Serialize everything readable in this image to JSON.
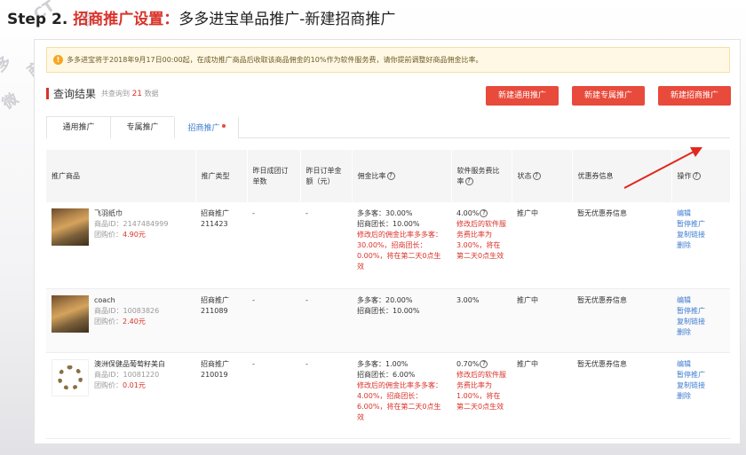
{
  "step": {
    "prefix": "Step 2.",
    "highlight": "招商推广设置：",
    "description": "多多进宝单品推广-新建招商推广"
  },
  "notice": {
    "text": "多多进宝将于2018年9月17日00:00起，在成功推广商品后收取该商品佣金的10%作为软件服务费，请你提前调整好商品佣金比率。"
  },
  "results": {
    "label": "查询结果",
    "count_prefix": "共查询到",
    "count": "21",
    "count_suffix": "数据"
  },
  "buttons": {
    "new_general": "新建通用推广",
    "new_exclusive": "新建专属推广",
    "new_merchant": "新建招商推广"
  },
  "tabs": [
    "通用推广",
    "专属推广",
    "招商推广"
  ],
  "table": {
    "headers": {
      "product": "推广商品",
      "type": "推广类型",
      "yesterday_orders": "昨日成团订单数",
      "yesterday_amount": "昨日订单金额（元）",
      "commission": "佣金比率",
      "service_fee": "软件服务费比率",
      "status": "状态",
      "coupon": "优惠券信息",
      "action": "操作"
    },
    "rows": [
      {
        "name": "飞羽纸巾",
        "product_id": "商品ID：2147484999",
        "price_label": "团购价：",
        "price": "4.90元",
        "type": "招商推广",
        "type_id": "211423",
        "orders": "-",
        "amount": "-",
        "commission_1": "多多客：30.00%",
        "commission_2": "招商团长：10.00%",
        "commission_note": "修改后的佣金比率多多客：30.00%，招商团长：0.00%，将在第二天0点生效",
        "fee": "4.00%",
        "fee_note": "修改后的软件服务费比率为3.00%，将在第二天0点生效",
        "status": "推广中",
        "coupon": "暂无优惠券信息",
        "actions": [
          "编辑",
          "暂停推广",
          "复制链接",
          "删除"
        ]
      },
      {
        "name": "coach",
        "product_id": "商品ID：10083826",
        "price_label": "团购价：",
        "price": "2.40元",
        "type": "招商推广",
        "type_id": "211089",
        "orders": "-",
        "amount": "-",
        "commission_1": "多多客：20.00%",
        "commission_2": "招商团长：10.00%",
        "commission_note": "",
        "fee": "3.00%",
        "fee_note": "",
        "status": "推广中",
        "coupon": "暂无优惠券信息",
        "actions": [
          "编辑",
          "暂停推广",
          "复制链接",
          "删除"
        ]
      },
      {
        "name": "澳洲保健品葡萄籽美白",
        "product_id": "商品ID：10081220",
        "price_label": "团购价：",
        "price": "0.01元",
        "type": "招商推广",
        "type_id": "210019",
        "orders": "-",
        "amount": "-",
        "commission_1": "多多客：1.00%",
        "commission_2": "招商团长：6.00%",
        "commission_note": "修改后的佣金比率多多客：4.00%，招商团长：6.00%，将在第二天0点生效",
        "fee": "0.70%",
        "fee_note": "修改后的软件服务费比率为1.00%，将在第二天0点生效",
        "status": "推广中",
        "coupon": "暂无优惠券信息",
        "actions": [
          "编辑",
          "暂停推广",
          "复制链接",
          "删除"
        ]
      }
    ]
  }
}
